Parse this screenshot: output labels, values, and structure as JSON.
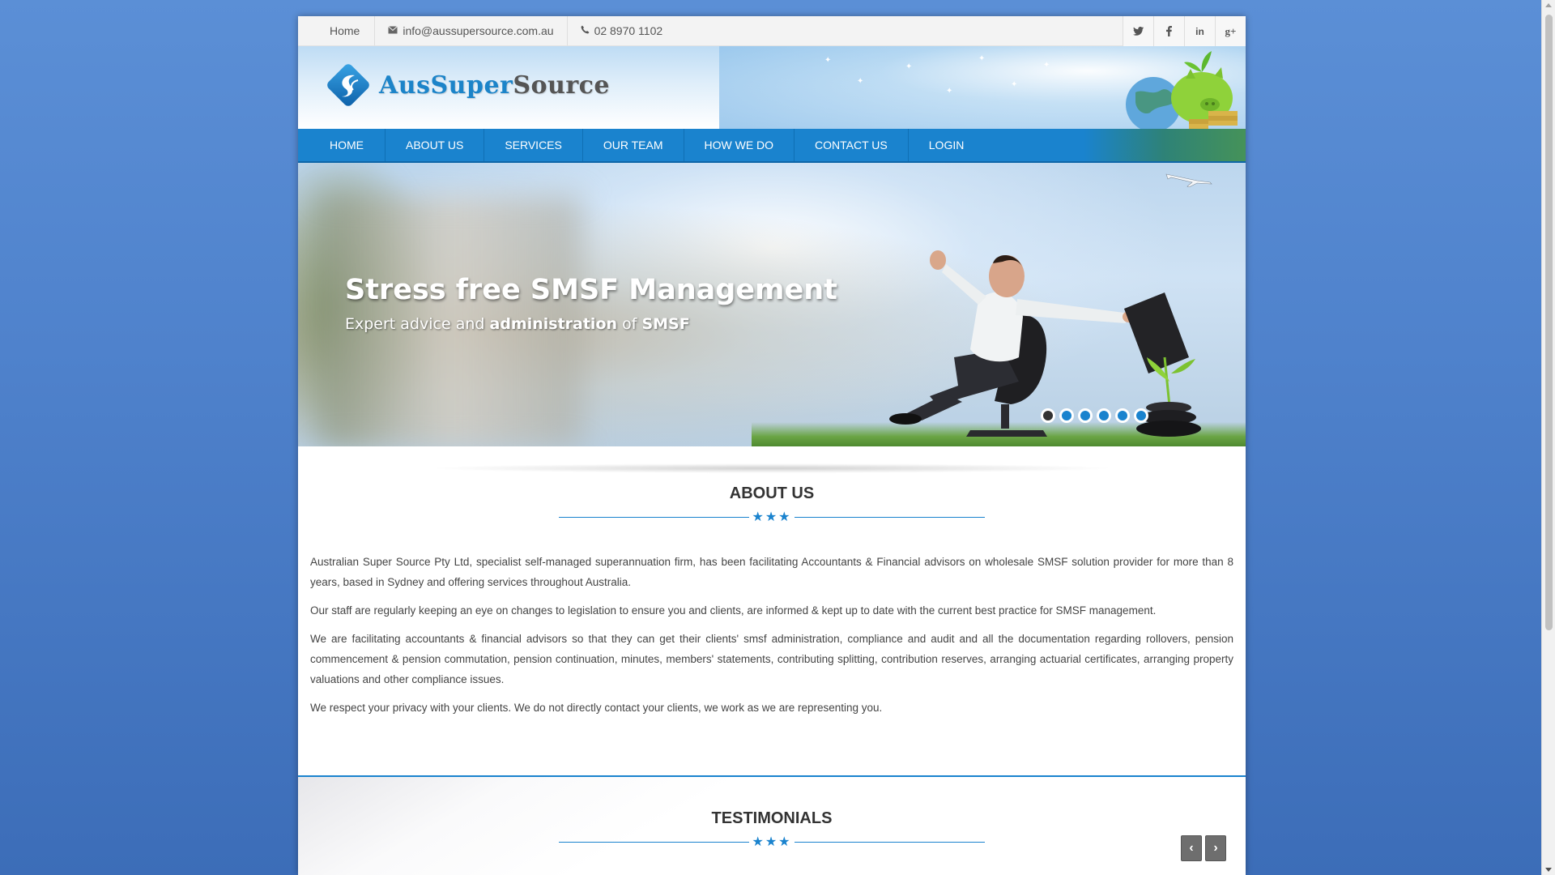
{
  "topbar": {
    "home_label": "Home",
    "email": "info@aussupersource.com.au",
    "phone": "02 8970 1102",
    "social": [
      {
        "icon": "twitter-icon",
        "glyph": "t"
      },
      {
        "icon": "facebook-icon",
        "glyph": "f"
      },
      {
        "icon": "linkedin-icon",
        "glyph": "in"
      },
      {
        "icon": "googleplus-icon",
        "glyph": "g+"
      }
    ]
  },
  "logo": {
    "part1": "Aus",
    "part2": "Super",
    "part3": "Source"
  },
  "nav": {
    "items": [
      "HOME",
      "ABOUT US",
      "SERVICES",
      "OUR TEAM",
      "HOW WE DO",
      "CONTACT US",
      "LOGIN"
    ]
  },
  "hero": {
    "title": "Stress free SMSF Management",
    "sub_plain1": "Expert advice and ",
    "sub_bold1": "administration",
    "sub_plain2": " of ",
    "sub_bold2": "SMSF",
    "slide_count": 6,
    "active_slide": 1
  },
  "about": {
    "title": "ABOUT US",
    "stars": "★★★",
    "paragraphs": [
      "Australian Super Source Pty Ltd, specialist self-managed superannuation firm, has been facilitating Accountants & Financial advisors on wholesale SMSF solution provider for more than 8 years, based in Sydney and offering services throughout Australia.",
      "Our staff are regularly keeping an eye on changes to legislation to ensure you and clients, are informed & kept up to date with the current best practice for SMSF management.",
      "We are facilitating accountants & financial advisors so that they can get their clients' smsf administration, compliance and audit and all the documentation regarding rollovers, pension commencement & pension commutation, pension continuation, minutes, members' statements, contributing splitting, contribution reserves, arranging actuarial certificates, arranging property valuations and other compliance issues.",
      "We respect your privacy with your clients. We do not directly contact your clients, we work as we are representing you."
    ]
  },
  "testimonials": {
    "title": "TESTIMONIALS",
    "stars": "★★★",
    "prev": "‹",
    "next": "›"
  },
  "colors": {
    "accent": "#1a83ce",
    "background": "#4f82cc"
  }
}
